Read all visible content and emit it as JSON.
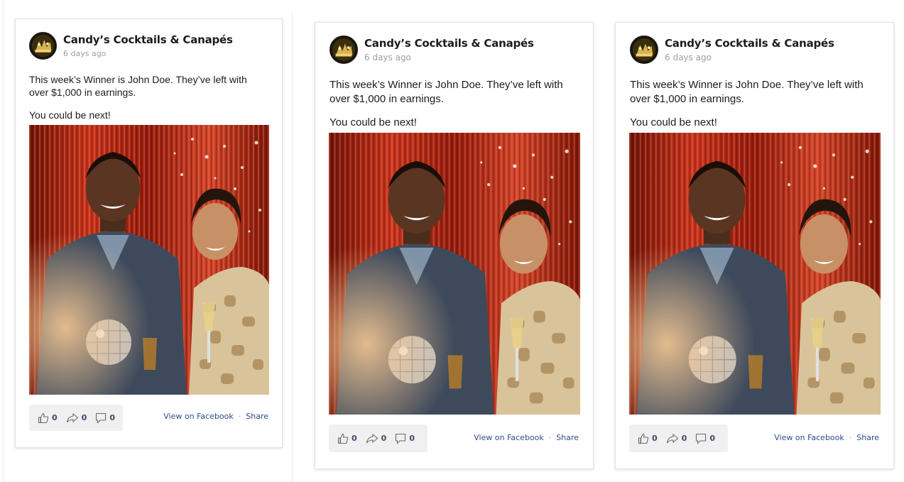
{
  "posts": [
    {
      "author": "Candy’s Cocktails & Canapés",
      "time": "6 days ago",
      "text_line1": "This week’s Winner is John Doe. They’ve left with over $1,000 in earnings.",
      "text_line2": "You could be next!",
      "likes": "0",
      "shares": "0",
      "comments": "0",
      "view_link": "View on Facebook",
      "separator": "·",
      "share_link": "Share"
    },
    {
      "author": "Candy’s Cocktails & Canapés",
      "time": "6 days ago",
      "text_line1": "This week’s Winner is John Doe. They’ve left with over $1,000 in earnings.",
      "text_line2": "You could be next!",
      "likes": "0",
      "shares": "0",
      "comments": "0",
      "view_link": "View on Facebook",
      "separator": "·",
      "share_link": "Share"
    },
    {
      "author": "Candy’s Cocktails & Canapés",
      "time": "6 days ago",
      "text_line1": "This week’s Winner is John Doe. They’ve left with over $1,000 in earnings.",
      "text_line2": "You could be next!",
      "likes": "0",
      "shares": "0",
      "comments": "0",
      "view_link": "View on Facebook",
      "separator": "·",
      "share_link": "Share"
    }
  ],
  "icons": {
    "like": "thumbs-up-icon",
    "share": "share-arrow-icon",
    "comment": "comment-bubble-icon"
  },
  "colors": {
    "link": "#2d4c8a",
    "reaction_bg": "#f0f0f0",
    "time": "#9aa0a6"
  }
}
